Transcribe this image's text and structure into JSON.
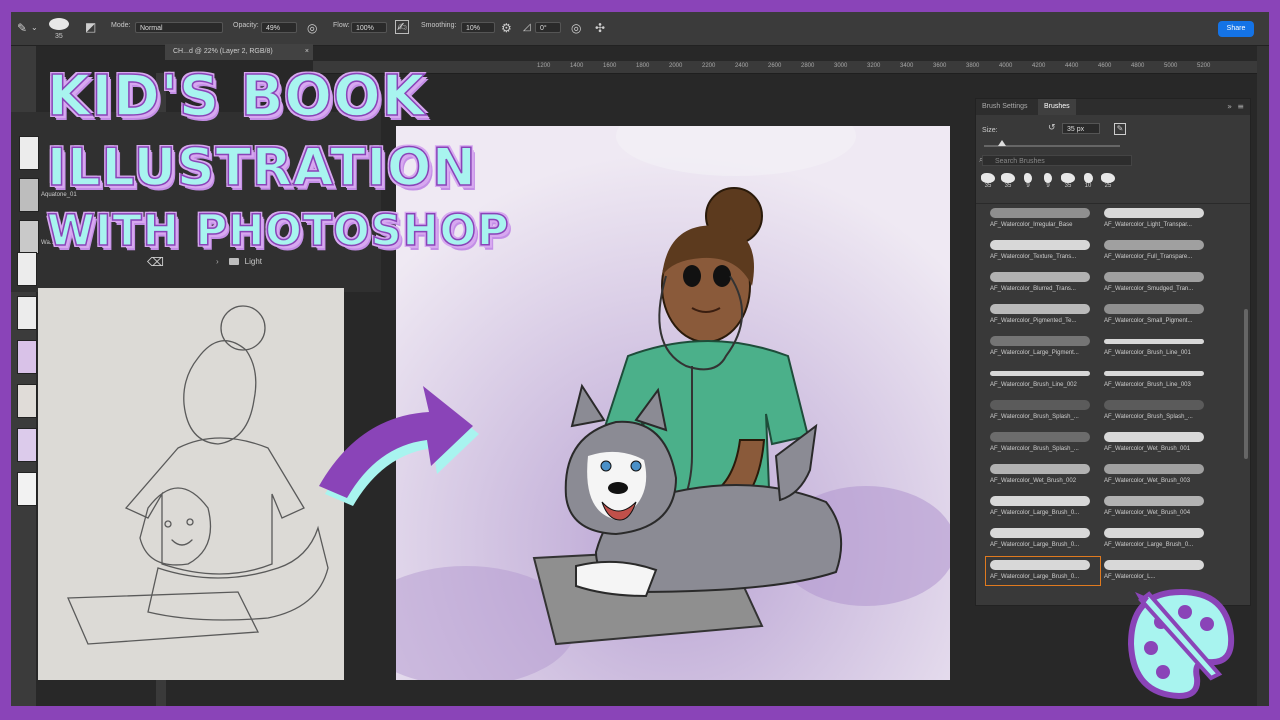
{
  "headline": {
    "line1": "KID'S BOOK",
    "line2": "ILLUSTRATION",
    "line3": "WITH PHOTOSHOP"
  },
  "options_bar": {
    "brush_size": "35",
    "mode_label": "Mode:",
    "mode_value": "Normal",
    "opacity_label": "Opacity:",
    "opacity_value": "49%",
    "flow_label": "Flow:",
    "flow_value": "100%",
    "smoothing_label": "Smoothing:",
    "smoothing_value": "10%",
    "angle_value": "0°",
    "share_label": "Share"
  },
  "document": {
    "tab_label": "CH...d @ 22% (Layer 2, RGB/8)"
  },
  "ruler": {
    "labels": [
      "1200",
      "1400",
      "1600",
      "1800",
      "2000",
      "2200",
      "2400",
      "2600",
      "2800",
      "3000",
      "3200",
      "3400",
      "3600",
      "3800",
      "4000",
      "4200",
      "4400",
      "4600",
      "4800",
      "5000",
      "5200"
    ]
  },
  "layers": {
    "folder_name": "Light",
    "layer_names": [
      "Aquatone_01",
      "Wa..."
    ]
  },
  "brushes_panel": {
    "tab_settings": "Brush Settings",
    "tab_brushes": "Brushes",
    "size_label": "Size:",
    "size_value": "35 px",
    "search_placeholder": "Search Brushes",
    "preset_sizes": [
      "35",
      "35",
      "9",
      "9",
      "35",
      "10",
      "25"
    ],
    "brushes": [
      "AF_Watercolor_Irregular_Base",
      "AF_Watercolor_Light_Transpar...",
      "AF_Watercolor_Texture_Trans...",
      "AF_Watercolor_Full_Transpare...",
      "AF_Watercolor_Blurred_Trans...",
      "AF_Watercolor_Smudged_Tran...",
      "AF_Watercolor_Pigmented_Te...",
      "AF_Watercolor_Small_Pigment...",
      "AF_Watercolor_Large_Pigment...",
      "AF_Watercolor_Brush_Line_001",
      "AF_Watercolor_Brush_Line_002",
      "AF_Watercolor_Brush_Line_003",
      "AF_Watercolor_Brush_Splash_...",
      "AF_Watercolor_Brush_Splash_...",
      "AF_Watercolor_Brush_Splash_...",
      "AF_Watercolor_Wet_Brush_001",
      "AF_Watercolor_Wet_Brush_002",
      "AF_Watercolor_Wet_Brush_003",
      "AF_Watercolor_Large_Brush_0...",
      "AF_Watercolor_Wet_Brush_004",
      "AF_Watercolor_Large_Brush_0...",
      "AF_Watercolor_Large_Brush_0...",
      "AF_Watercolor_Large_Brush_0...",
      "AF_Watercolor_L..."
    ],
    "selected_index": 22
  },
  "colors": {
    "frame": "#8a44b8",
    "headline_fill": "#a8f4ef",
    "arrow": "#8a44b8",
    "canvas_bg": "#e9e2ef",
    "scrubs": "#4bb08a",
    "selection": "#e07a1f",
    "share_button": "#1473e6"
  }
}
